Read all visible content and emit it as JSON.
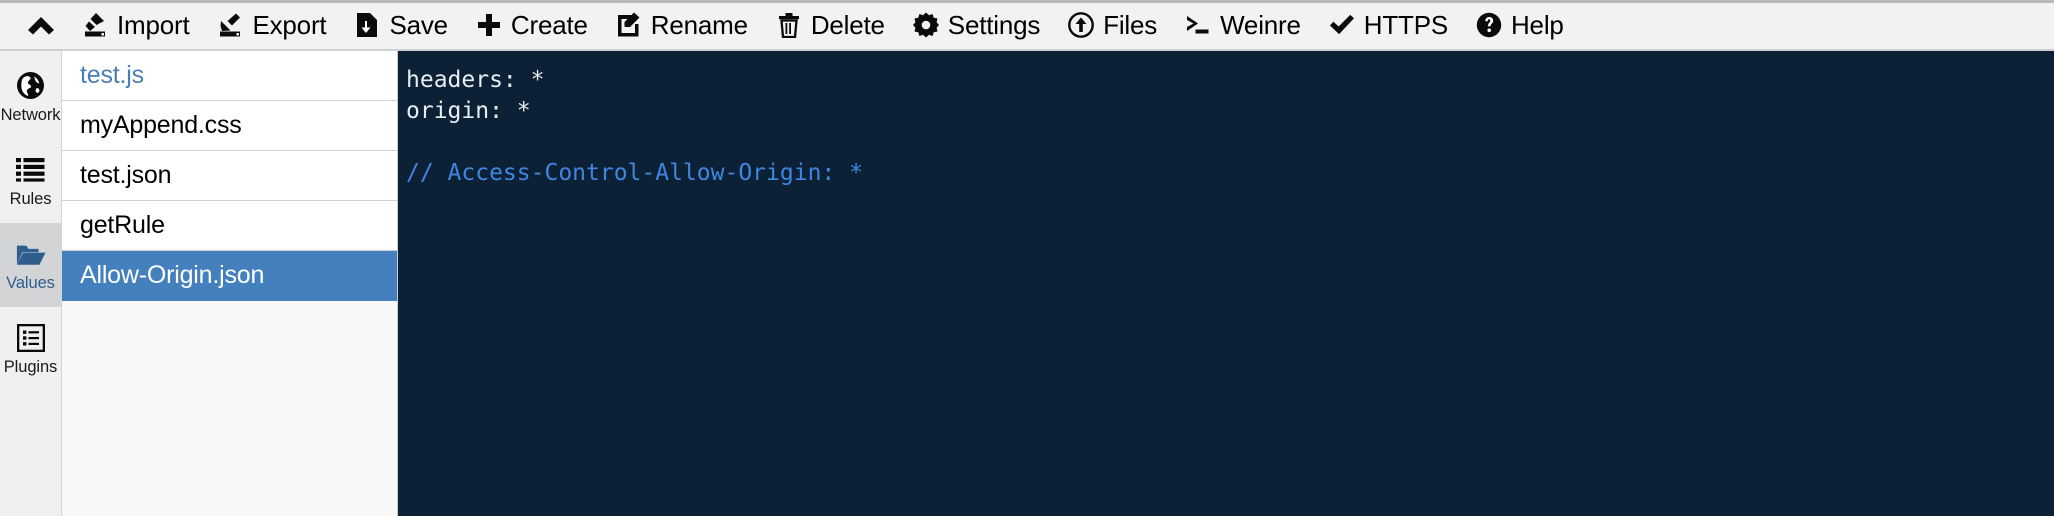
{
  "toolbar": {
    "collapse_icon": "chevron-up-icon",
    "buttons": [
      {
        "label": "Import",
        "icon": "import-icon"
      },
      {
        "label": "Export",
        "icon": "export-icon"
      },
      {
        "label": "Save",
        "icon": "save-disk-icon"
      },
      {
        "label": "Create",
        "icon": "plus-icon"
      },
      {
        "label": "Rename",
        "icon": "edit-square-icon"
      },
      {
        "label": "Delete",
        "icon": "trash-icon"
      },
      {
        "label": "Settings",
        "icon": "gear-icon"
      },
      {
        "label": "Files",
        "icon": "upload-circle-icon"
      },
      {
        "label": "Weinre",
        "icon": "terminal-prompt-icon"
      },
      {
        "label": "HTTPS",
        "icon": "check-icon"
      },
      {
        "label": "Help",
        "icon": "question-circle-icon"
      }
    ]
  },
  "rail": {
    "items": [
      {
        "label": "Network",
        "icon": "globe-icon",
        "active": false
      },
      {
        "label": "Rules",
        "icon": "list-icon",
        "active": false
      },
      {
        "label": "Values",
        "icon": "folder-open-icon",
        "active": true
      },
      {
        "label": "Plugins",
        "icon": "plugin-list-icon",
        "active": false
      }
    ]
  },
  "filelist": {
    "items": [
      {
        "name": "test.js",
        "state": "link"
      },
      {
        "name": "myAppend.css",
        "state": "normal"
      },
      {
        "name": "test.json",
        "state": "normal"
      },
      {
        "name": "getRule",
        "state": "normal"
      },
      {
        "name": "Allow-Origin.json",
        "state": "selected"
      }
    ]
  },
  "editor": {
    "lines": [
      {
        "text": "headers: *",
        "kind": "code"
      },
      {
        "text": "origin: *",
        "kind": "code"
      },
      {
        "text": " ",
        "kind": "blank"
      },
      {
        "text": "// Access-Control-Allow-Origin: *",
        "kind": "comment"
      }
    ]
  },
  "colors": {
    "toolbar_bg": "#f1f2f4",
    "rail_bg": "#eff0f2",
    "rail_active_bg": "#d3d4d6",
    "accent_blue": "#4480be",
    "link_blue": "#4a7fb5",
    "editor_bg": "#0c2135",
    "editor_fg": "#e8edf2",
    "comment_blue": "#3f86e0"
  }
}
